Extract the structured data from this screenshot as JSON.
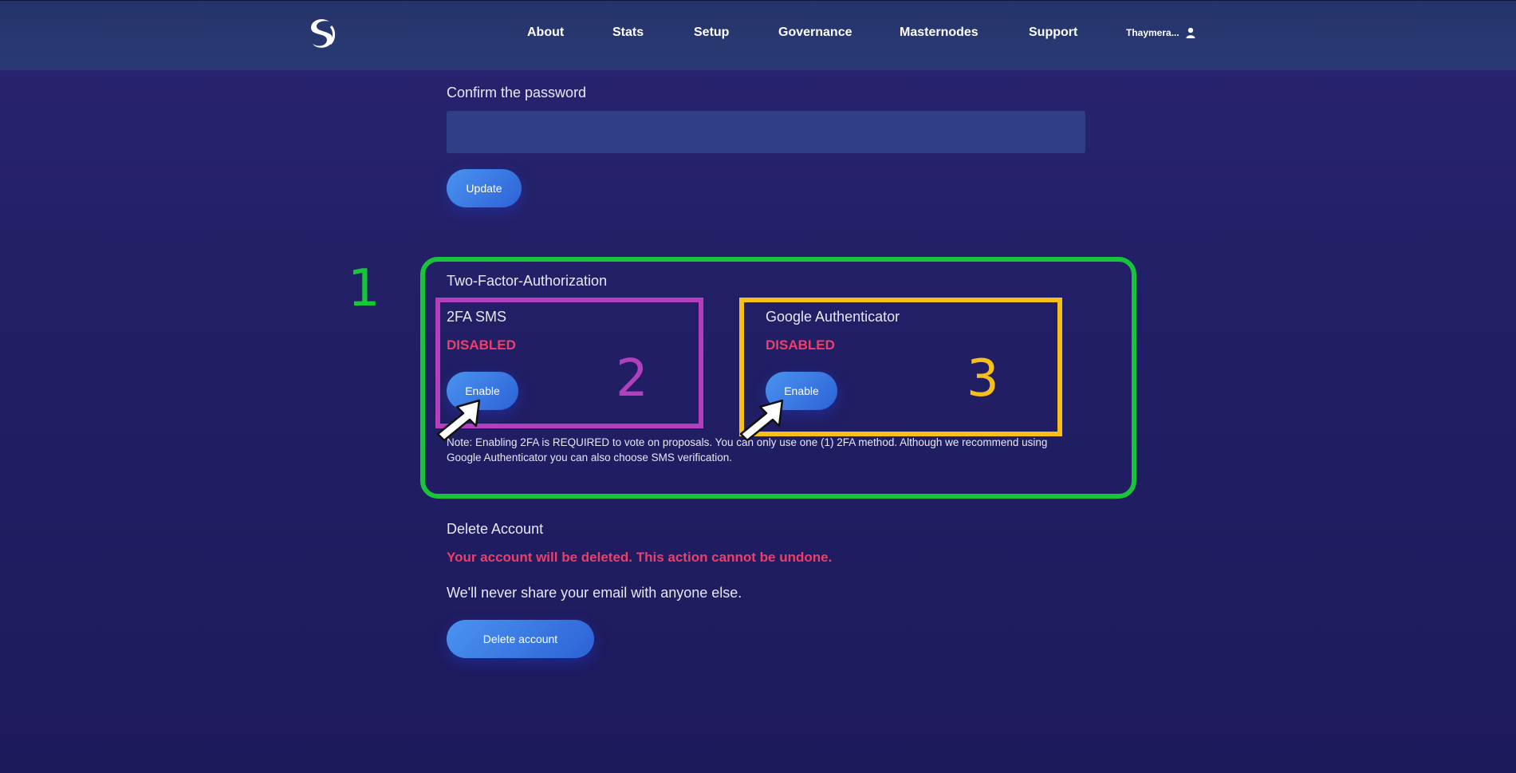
{
  "nav": {
    "items": [
      {
        "label": "About"
      },
      {
        "label": "Stats"
      },
      {
        "label": "Setup"
      },
      {
        "label": "Governance"
      },
      {
        "label": "Masternodes"
      },
      {
        "label": "Support"
      }
    ],
    "user": "Thaymera..."
  },
  "password": {
    "confirm_label": "Confirm the password",
    "confirm_value": "",
    "update_label": "Update"
  },
  "two_factor": {
    "title": "Two-Factor-Authorization",
    "sms": {
      "title": "2FA SMS",
      "status": "DISABLED",
      "button": "Enable"
    },
    "google": {
      "title": "Google Authenticator",
      "status": "DISABLED",
      "button": "Enable"
    },
    "note": "Note: Enabling 2FA is REQUIRED to vote on proposals. You can only use one (1) 2FA method. Although we recommend using Google Authenticator you can also choose SMS verification."
  },
  "delete": {
    "title": "Delete Account",
    "warning": "Your account will be deleted. This action cannot be undone.",
    "info": "We'll never share your email with anyone else.",
    "button": "Delete account"
  },
  "annotations": {
    "n1": "1",
    "n2": "2",
    "n3": "3",
    "color_green": "#18c43a",
    "color_purple": "#b33fbf",
    "color_yellow": "#f7bf1a"
  },
  "colors": {
    "accent": "#3b7be6",
    "danger": "#ee3e6a"
  }
}
